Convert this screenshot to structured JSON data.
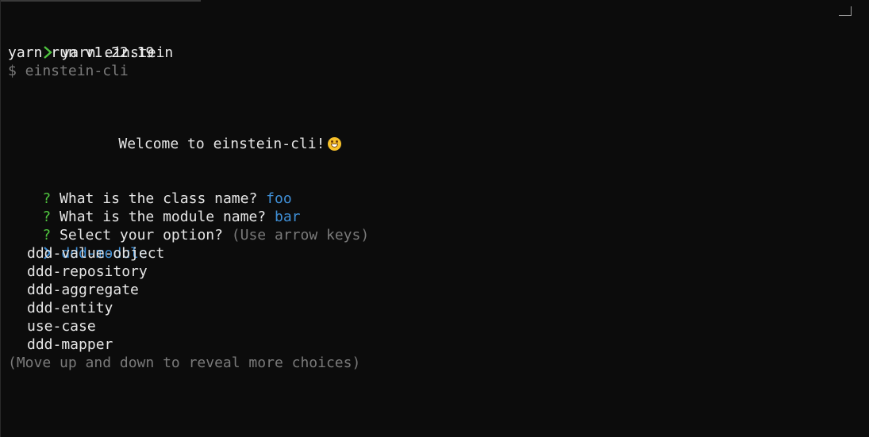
{
  "terminal": {
    "prompt_command": "yarn einstein",
    "yarn_version_line": "yarn run v1.22.19",
    "script_line": "$ einstein-cli",
    "welcome_text": "Welcome to einstein-cli!",
    "welcome_emoji": "grinning-face-icon",
    "questions": [
      {
        "mark": "?",
        "text": "What is the class name?",
        "answer": "foo"
      },
      {
        "mark": "?",
        "text": "What is the module name?",
        "answer": "bar"
      },
      {
        "mark": "?",
        "text": "Select your option?",
        "hint": "(Use arrow keys)"
      }
    ],
    "options": [
      {
        "label": "ddd-module",
        "selected": true
      },
      {
        "label": "ddd-value-object",
        "selected": false
      },
      {
        "label": "ddd-repository",
        "selected": false
      },
      {
        "label": "ddd-aggregate",
        "selected": false
      },
      {
        "label": "ddd-entity",
        "selected": false
      },
      {
        "label": "use-case",
        "selected": false
      },
      {
        "label": "ddd-mapper",
        "selected": false
      }
    ],
    "footer_hint": "(Move up and down to reveal more choices)"
  },
  "colors": {
    "background": "#0c0c0c",
    "prompt_chevron": "#4fc43f",
    "answer": "#3f8fd6",
    "dim_text": "#7a7a7a",
    "question_mark": "#4fc43f"
  }
}
